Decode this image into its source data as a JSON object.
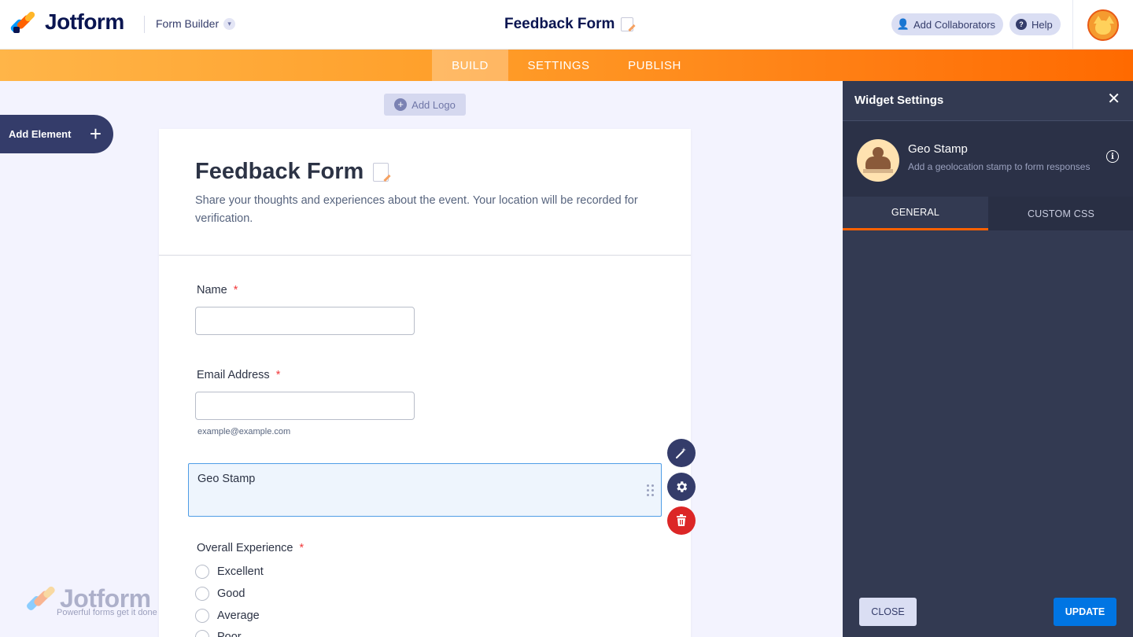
{
  "header": {
    "brand": "Jotform",
    "builder_label": "Form Builder",
    "form_title": "Feedback Form",
    "add_collaborators": "Add Collaborators",
    "help": "Help"
  },
  "nav": {
    "tabs": [
      {
        "label": "BUILD",
        "active": true
      },
      {
        "label": "SETTINGS",
        "active": false
      },
      {
        "label": "PUBLISH",
        "active": false
      }
    ]
  },
  "sidebar": {
    "add_element": "Add Element"
  },
  "canvas": {
    "add_logo": "Add Logo"
  },
  "form": {
    "title": "Feedback Form",
    "description": "Share your thoughts and experiences about the event. Your location will be recorded for verification.",
    "fields": {
      "name_label": "Name",
      "email_label": "Email Address",
      "email_sublabel": "example@example.com",
      "geo_label": "Geo Stamp",
      "experience_label": "Overall Experience",
      "required_mark": "*",
      "options": [
        "Excellent",
        "Good",
        "Average",
        "Poor"
      ]
    }
  },
  "watermark": {
    "brand": "Jotform",
    "tagline": "Powerful forms get it done"
  },
  "panel": {
    "title": "Widget Settings",
    "widget_name": "Geo Stamp",
    "widget_desc": "Add a geolocation stamp to form responses",
    "tabs": [
      {
        "label": "GENERAL",
        "active": true
      },
      {
        "label": "CUSTOM CSS",
        "active": false
      }
    ],
    "close_button": "CLOSE",
    "update_button": "UPDATE"
  },
  "colors": {
    "accent_orange": "#ff6100",
    "dark_navy": "#343c6a",
    "primary_blue": "#0075e3",
    "required_red": "#f23a3c"
  }
}
